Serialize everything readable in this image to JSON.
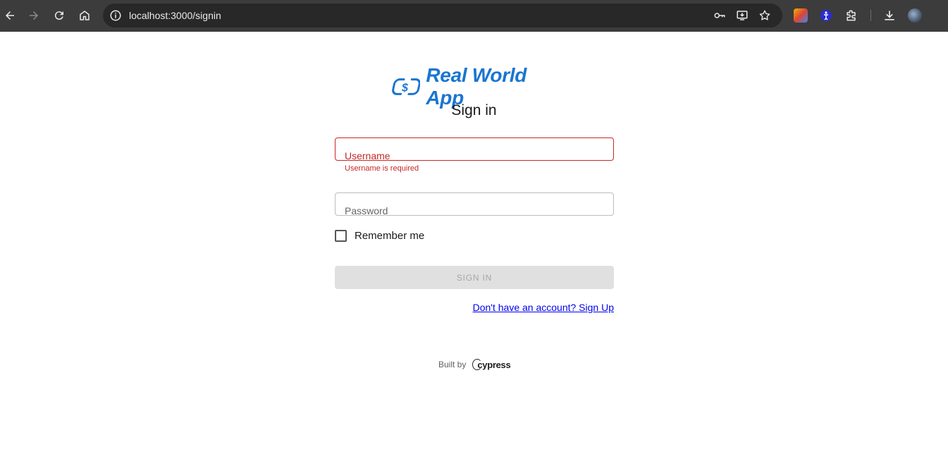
{
  "browser": {
    "url": "localhost:3000/signin"
  },
  "app": {
    "name": "Real World App",
    "brand_color": "#1a75d1"
  },
  "form": {
    "heading": "Sign in",
    "username_label": "Username",
    "username_error": "Username is required",
    "password_label": "Password",
    "remember_label": "Remember me",
    "submit_label": "SIGN IN",
    "signup_link": "Don't have an account? Sign Up",
    "error_color": "#c62828"
  },
  "footer": {
    "built_by": "Built by",
    "brand": "cypress"
  }
}
